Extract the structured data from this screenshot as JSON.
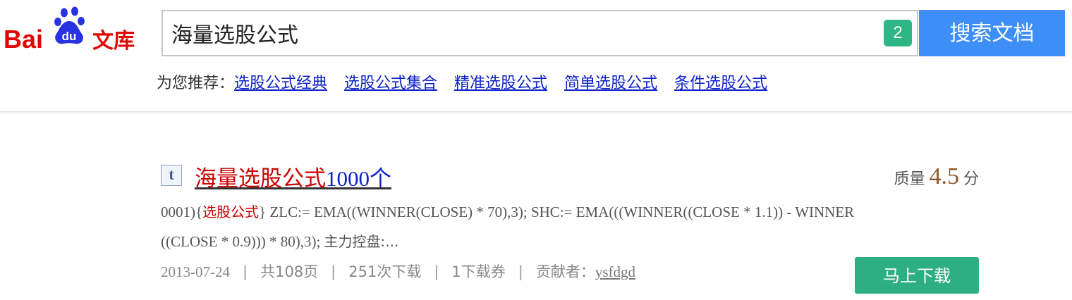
{
  "logo": {
    "text_bai": "Bai",
    "text_du": "du",
    "text_wenku": "文库"
  },
  "search": {
    "value": "海量选股公式",
    "badge": "2",
    "button_label": "搜索文档"
  },
  "recommend": {
    "label": "为您推荐：",
    "items": [
      "选股公式经典",
      "选股公式集合",
      "精准选股公式",
      "简单选股公式",
      "条件选股公式"
    ]
  },
  "result": {
    "icon_letter": "t",
    "title_highlight": "海量选股公式",
    "title_rest": "1000个",
    "quality_label": "质量",
    "quality_score": "4.5",
    "quality_unit": "分",
    "summary_line1_pre": "0001){",
    "summary_line1_hl": "选股公式",
    "summary_line1_post": "} ZLC:= EMA((WINNER(CLOSE) * 70),3); SHC:= EMA(((WINNER((CLOSE * 1.1)) - WINNER",
    "summary_line2_pre": "((CLOSE * 0.9))) * 80),3); ",
    "summary_line2_cn": "主力控盘:...",
    "meta": {
      "date": "2013-07-24",
      "pages": "共108页",
      "downloads": "251次下载",
      "tickets": "1下载券",
      "contributor_label": "贡献者：",
      "contributor": "ysfdgd",
      "separator": "|"
    },
    "download_button": "马上下载"
  },
  "colors": {
    "accent_blue": "#3e8ef7",
    "green": "#2eaf83",
    "highlight_red": "#cc0000",
    "link_blue": "#0e22c9"
  }
}
